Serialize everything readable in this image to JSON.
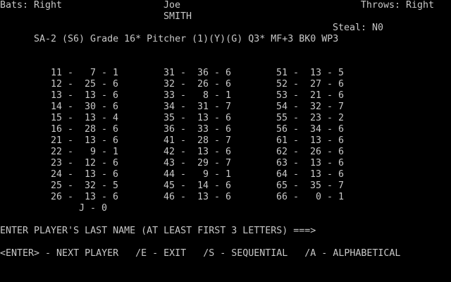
{
  "header": {
    "bats": "Bats: Right",
    "player_first": "Joe",
    "player_last": "SMITH",
    "throws": "Throws: Right",
    "steal": "Steal: N0",
    "grade_line": "SA-2 (S6) Grade 16* Pitcher (1)(Y)(G) Q3* MF+3 BK0 WP3"
  },
  "columns": [
    [
      "11 -   7 - 1",
      "12 -  25 - 6",
      "13 -  13 - 6",
      "14 -  30 - 6",
      "15 -  13 - 4",
      "16 -  28 - 6",
      "21 -  13 - 6",
      "22 -   9 - 1",
      "23 -  12 - 6",
      "24 -  13 - 6",
      "25 -  32 - 5",
      "26 -  13 - 6"
    ],
    [
      "31 -  36 - 6",
      "32 -  26 - 6",
      "33 -   8 - 1",
      "34 -  31 - 7",
      "35 -  13 - 6",
      "36 -  33 - 6",
      "41 -  28 - 7",
      "42 -  13 - 6",
      "43 -  29 - 7",
      "44 -   9 - 1",
      "45 -  14 - 6",
      "46 -  13 - 6"
    ],
    [
      "51 -  13 - 5",
      "52 -  27 - 6",
      "53 -  21 - 6",
      "54 -  32 - 7",
      "55 -  23 - 2",
      "56 -  34 - 6",
      "61 -  13 - 6",
      "62 -  26 - 6",
      "63 -  13 - 6",
      "64 -  13 - 6",
      "65 -  35 - 7",
      "66 -   0 - 1"
    ]
  ],
  "j_line": "J - 0",
  "prompt": "ENTER PLAYER'S LAST NAME (AT LEAST FIRST 3 LETTERS) ===>",
  "footer": "<ENTER> - NEXT PLAYER   /E - EXIT   /S - SEQUENTIAL   /A - ALPHABETICAL"
}
